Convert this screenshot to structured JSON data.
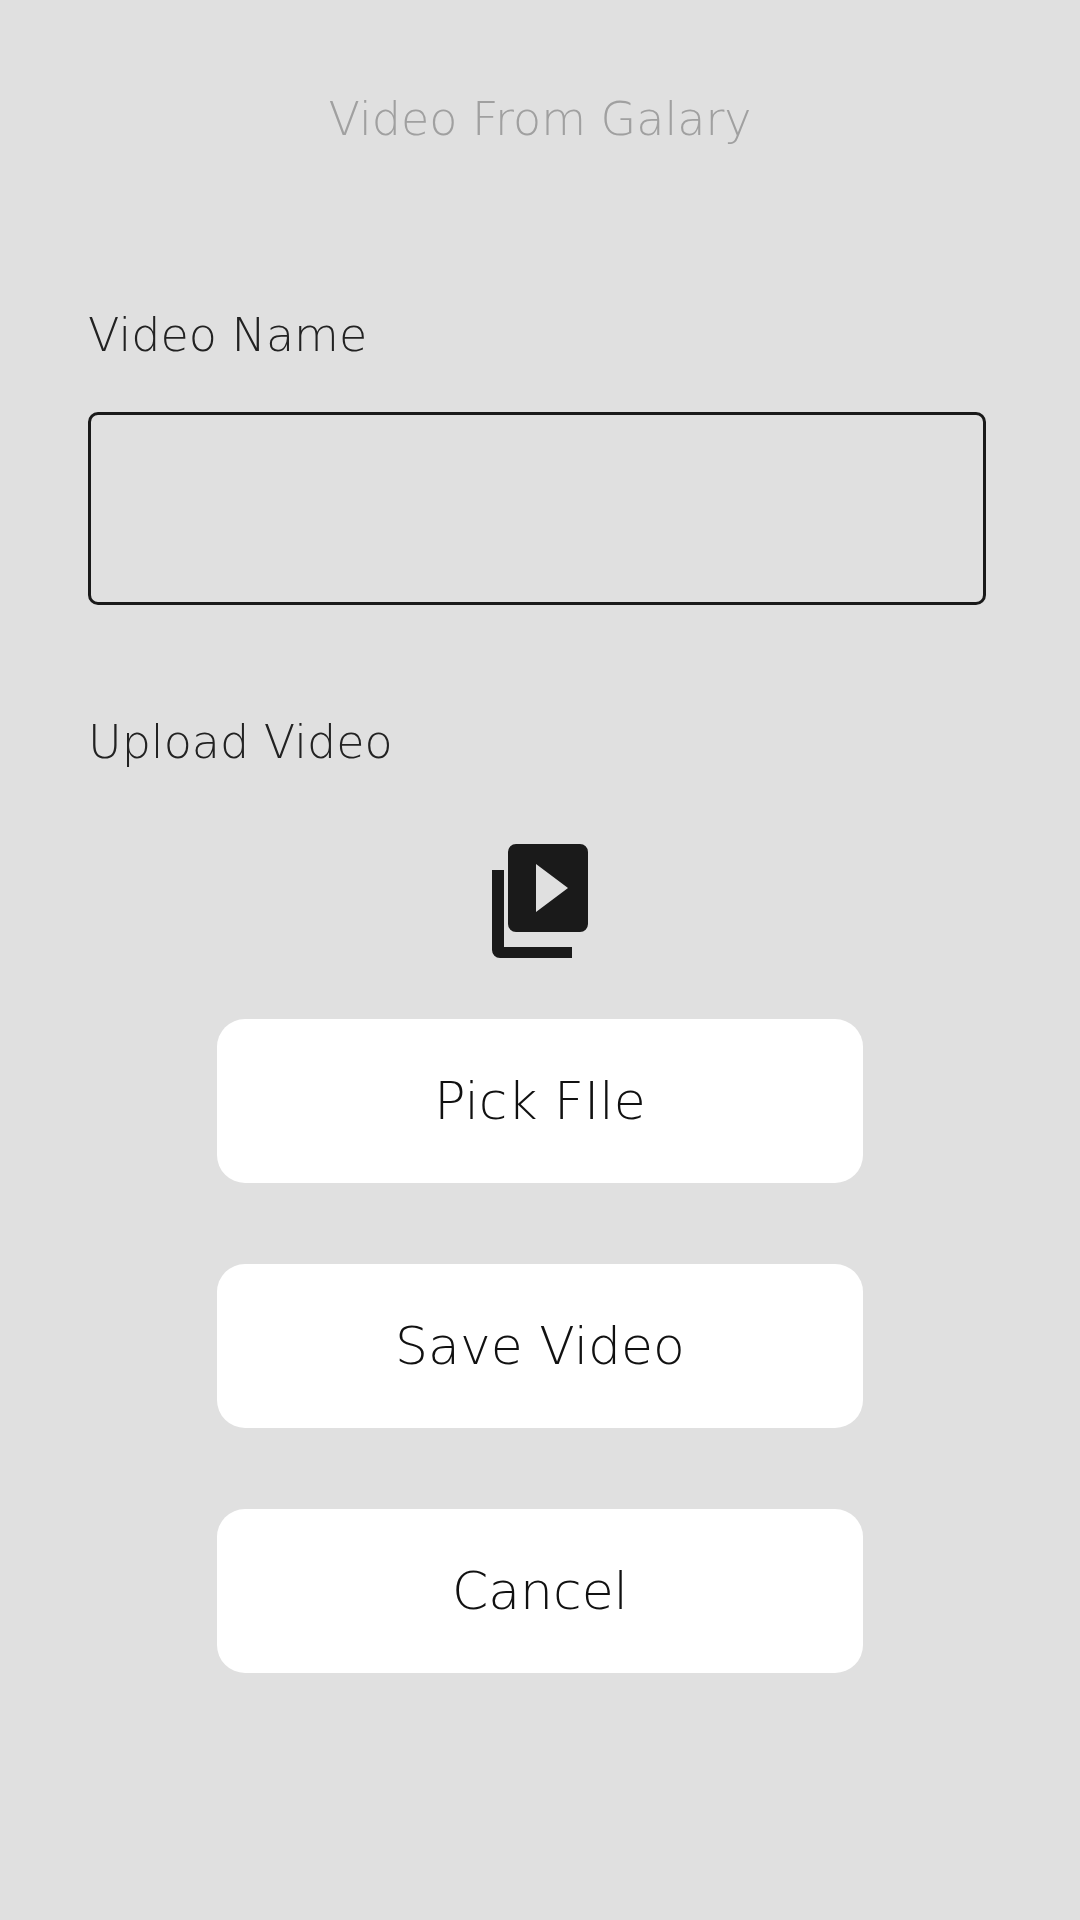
{
  "title": "Video From Galary",
  "name_field": {
    "label": "Video Name"
  },
  "upload": {
    "label": "Upload Video"
  },
  "buttons": [
    "Pick FIle",
    "Save Video",
    "Cancel"
  ]
}
